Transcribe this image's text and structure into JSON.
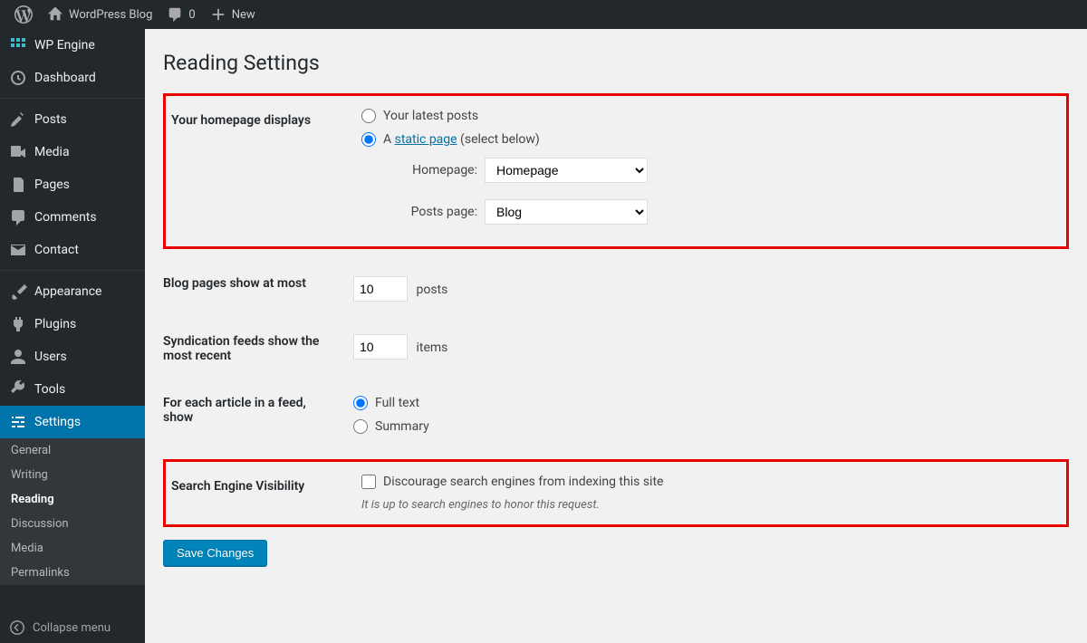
{
  "adminbar": {
    "site_name": "WordPress Blog",
    "comments_count": "0",
    "new_label": "New"
  },
  "sidebar": {
    "items": [
      {
        "label": "WP Engine"
      },
      {
        "label": "Dashboard"
      },
      {
        "label": "Posts"
      },
      {
        "label": "Media"
      },
      {
        "label": "Pages"
      },
      {
        "label": "Comments"
      },
      {
        "label": "Contact"
      },
      {
        "label": "Appearance"
      },
      {
        "label": "Plugins"
      },
      {
        "label": "Users"
      },
      {
        "label": "Tools"
      },
      {
        "label": "Settings"
      }
    ],
    "submenu": [
      {
        "label": "General"
      },
      {
        "label": "Writing"
      },
      {
        "label": "Reading"
      },
      {
        "label": "Discussion"
      },
      {
        "label": "Media"
      },
      {
        "label": "Permalinks"
      }
    ],
    "collapse_label": "Collapse menu"
  },
  "page": {
    "title": "Reading Settings",
    "homepage_displays": {
      "label": "Your homepage displays",
      "opt_latest": "Your latest posts",
      "opt_static_prefix": "A ",
      "opt_static_link": "static page",
      "opt_static_suffix": " (select below)",
      "homepage_label": "Homepage:",
      "homepage_value": "Homepage",
      "postspage_label": "Posts page:",
      "postspage_value": "Blog"
    },
    "blog_pages": {
      "label": "Blog pages show at most",
      "value": "10",
      "suffix": "posts"
    },
    "syndication": {
      "label": "Syndication feeds show the most recent",
      "value": "10",
      "suffix": "items"
    },
    "feed_article": {
      "label": "For each article in a feed, show",
      "opt_full": "Full text",
      "opt_summary": "Summary"
    },
    "search_visibility": {
      "label": "Search Engine Visibility",
      "checkbox_label": "Discourage search engines from indexing this site",
      "desc": "It is up to search engines to honor this request."
    },
    "save_button": "Save Changes"
  }
}
